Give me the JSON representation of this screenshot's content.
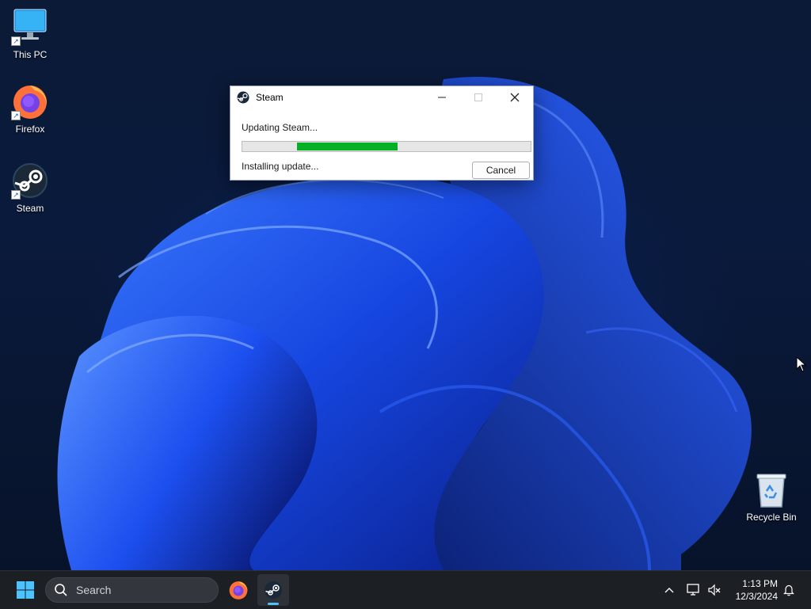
{
  "desktop": {
    "icons": [
      {
        "label": "This PC",
        "icon": "monitor-icon"
      },
      {
        "label": "Firefox",
        "icon": "firefox-icon"
      },
      {
        "label": "Steam",
        "icon": "steam-icon"
      },
      {
        "label": "Recycle Bin",
        "icon": "recycle-bin-icon"
      }
    ]
  },
  "dialog": {
    "title": "Steam",
    "status": "Updating Steam...",
    "substatus": "Installing update...",
    "cancel_label": "Cancel",
    "progress": 0.35,
    "accent_color": "#06b025"
  },
  "taskbar": {
    "search_placeholder": "Search",
    "pinned": [
      "firefox-icon",
      "steam-icon"
    ],
    "active_app": "Steam",
    "clock_time": "1:13 PM",
    "clock_date": "12/3/2024",
    "tray": [
      "chevron-up-icon",
      "network-icon",
      "volume-muted-icon",
      "notification-bell-icon"
    ]
  }
}
